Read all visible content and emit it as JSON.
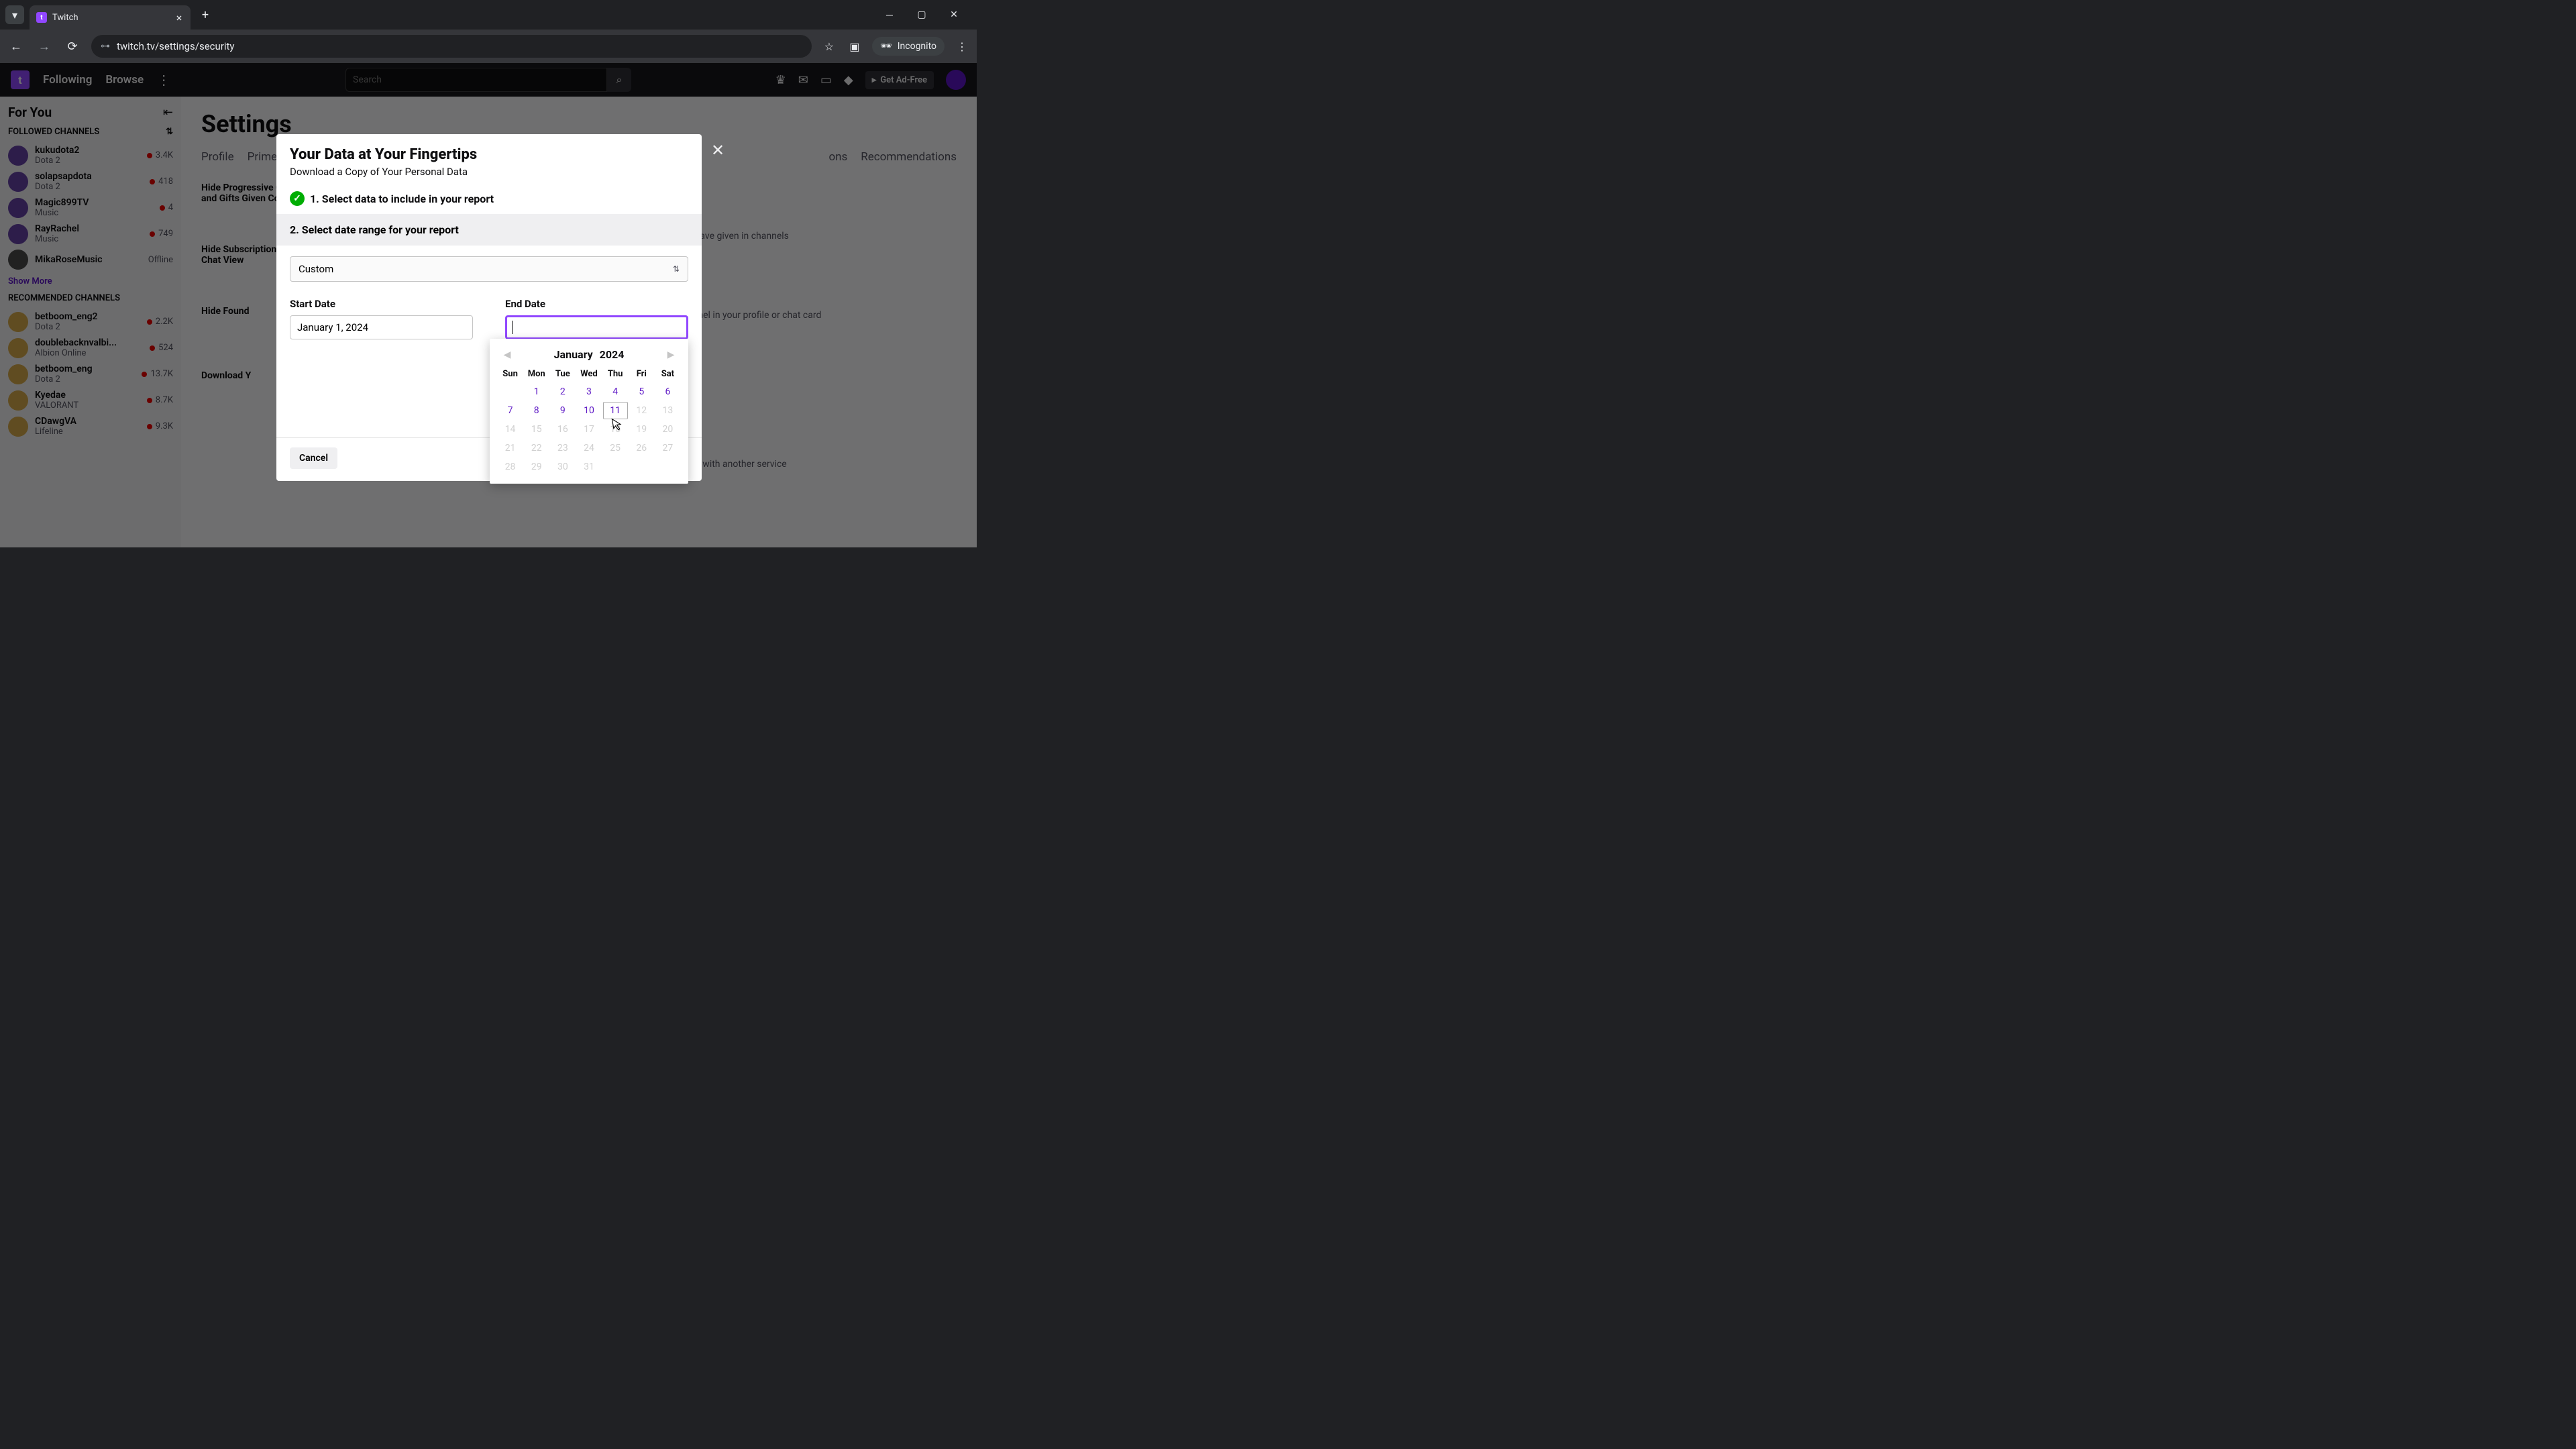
{
  "browser": {
    "tab_title": "Twitch",
    "url": "twitch.tv/settings/security",
    "incognito_label": "Incognito"
  },
  "nav": {
    "following": "Following",
    "browse": "Browse",
    "search_placeholder": "Search",
    "ad_free": "Get Ad-Free"
  },
  "sidebar": {
    "for_you": "For You",
    "followed_header": "FOLLOWED CHANNELS",
    "recommended_header": "RECOMMENDED CHANNELS",
    "show_more": "Show More",
    "followed": [
      {
        "name": "kukudota2",
        "game": "Dota 2",
        "viewers": "3.4K",
        "live": true
      },
      {
        "name": "solapsapdota",
        "game": "Dota 2",
        "viewers": "418",
        "live": true
      },
      {
        "name": "Magic899TV",
        "game": "Music",
        "viewers": "4",
        "live": true
      },
      {
        "name": "RayRachel",
        "game": "Music",
        "viewers": "749",
        "live": true
      },
      {
        "name": "MikaRoseMusic",
        "game": "",
        "viewers": "Offline",
        "live": false
      }
    ],
    "recommended": [
      {
        "name": "betboom_eng2",
        "game": "Dota 2",
        "viewers": "2.2K",
        "live": true
      },
      {
        "name": "doublebacknvalbi...",
        "game": "Albion Online",
        "viewers": "524",
        "live": true
      },
      {
        "name": "betboom_eng",
        "game": "Dota 2",
        "viewers": "13.7K",
        "live": true
      },
      {
        "name": "Kyedae",
        "game": "VALORANT",
        "viewers": "8.7K",
        "live": true
      },
      {
        "name": "CDawgVA",
        "game": "Lifeline",
        "viewers": "9.3K",
        "live": true
      }
    ]
  },
  "page": {
    "title": "Settings",
    "tabs": [
      "Profile",
      "Prime",
      "",
      "",
      "",
      "Recommendations"
    ],
    "tab_notifications_fragment": "ons",
    "setting1_label": "Hide Progressive Gifter Badge and Gifts Given Count",
    "setting1_desc": "you have given in channels",
    "setting2_label": "Hide Subscription Status in Chat View",
    "setting2_desc": "channel in your profile or chat card",
    "setting3_label": "Hide Found",
    "setting4_label": "Download Y",
    "setting4_desc": "use it with another service"
  },
  "modal": {
    "title": "Your Data at Your Fingertips",
    "subtitle": "Download a Copy of Your Personal Data",
    "step1": "1. Select data to include in your report",
    "step2": "2. Select date range for your report",
    "range_value": "Custom",
    "start_label": "Start Date",
    "start_value": "January 1, 2024",
    "end_label": "End Date",
    "end_value": "",
    "cancel": "Cancel"
  },
  "calendar": {
    "month": "January",
    "year": "2024",
    "dow": [
      "Sun",
      "Mon",
      "Tue",
      "Wed",
      "Thu",
      "Fri",
      "Sat"
    ],
    "weeks": [
      [
        "",
        "1",
        "2",
        "3",
        "4",
        "5",
        "6"
      ],
      [
        "7",
        "8",
        "9",
        "10",
        "11",
        "12",
        "13"
      ],
      [
        "14",
        "15",
        "16",
        "17",
        "18",
        "19",
        "20"
      ],
      [
        "21",
        "22",
        "23",
        "24",
        "25",
        "26",
        "27"
      ],
      [
        "28",
        "29",
        "30",
        "31",
        "",
        "",
        ""
      ]
    ],
    "enabled_through": 11,
    "hover_day": 11
  }
}
